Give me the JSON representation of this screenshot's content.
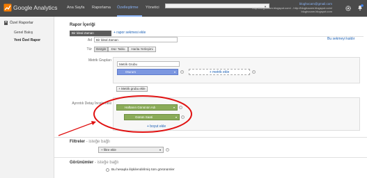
{
  "header": {
    "app_name": "Google Analytics",
    "nav": [
      "Ana Sayfa",
      "Raporlama",
      "Özelleştirme",
      "Yönetici"
    ],
    "user_email": "bloghocam@gmail.com",
    "user_property": "http://bloghocam.blogspot.com/ - http://bloghocam.blogspot.com/",
    "user_blog": "bloghocam.blogspot.com"
  },
  "sidebar": {
    "heading": "Özel Raporlar",
    "items": [
      "Genel Bakış",
      "Yeni Özel Rapor"
    ]
  },
  "report": {
    "section_title": "Rapor İçeriği",
    "tab_label": "Bir İdeal Zaman",
    "add_tab_link": "+ rapor sekmesi ekle",
    "delete_tab_link": "Bu sekmeyi kaldır",
    "name_label": "Ad",
    "name_value": "Bir İdeal Zaman",
    "type_label": "Tür",
    "type_options": [
      "Gezgin",
      "Düz Tablo",
      "Harita Yerleşimi"
    ],
    "metric_groups_label": "Metrik Grupları",
    "metric_group_name": "Metrik Grubu",
    "metric_chip": "Oturum",
    "add_metric": "+ metrik ekle",
    "add_metric_group": "+ Metrik grubu ekle",
    "drilldown_label": "Ayrıntılı Detay İncelemesi",
    "dimension_1": "Haftanın Gününün Adı",
    "dimension_2": "Günün Saati",
    "add_dimension": "+ boyut ekle"
  },
  "filters": {
    "title": "Filtreler",
    "subtitle": "- isteğe bağlı",
    "add_filter": "+ filtre ekle"
  },
  "views": {
    "title": "Görünümler",
    "subtitle": "- isteğe bağlı",
    "option": "Bu hesapla ilişkilendirilmiş tüm görünümler"
  },
  "colors": {
    "topbar": "#4a4a4a",
    "metric_blue": "#7c97e0",
    "dimension_green": "#8aab58",
    "annotation_red": "#e01010"
  }
}
